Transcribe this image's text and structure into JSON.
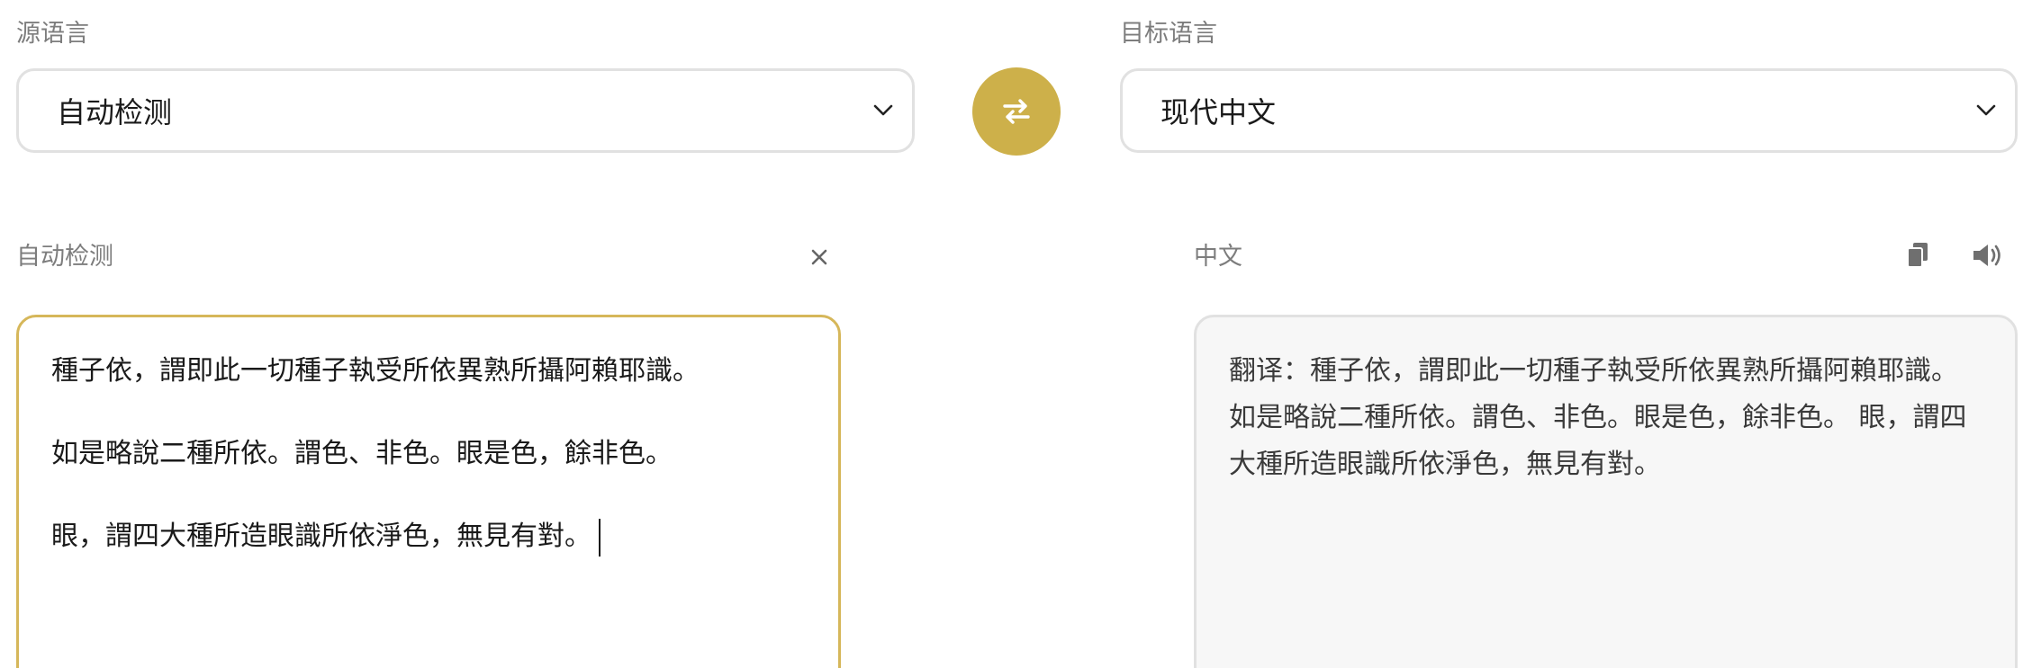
{
  "source_language": {
    "label": "源语言",
    "selected": "自动检测"
  },
  "target_language": {
    "label": "目标语言",
    "selected": "现代中文"
  },
  "swap_button": {
    "icon": "swap-arrows-icon",
    "color": "#cdb04a"
  },
  "source_panel": {
    "label": "自动检测",
    "clear_icon": "close-icon",
    "lines": [
      "種子依，謂即此一切種子執受所依異熟所攝阿賴耶識。",
      "如是略說二種所依。謂色、非色。眼是色，餘非色。",
      "眼，謂四大種所造眼識所依淨色，無見有對。"
    ],
    "accent_color": "#d6b75a"
  },
  "target_panel": {
    "label": "中文",
    "copy_icon": "copy-icon",
    "speaker_icon": "speaker-icon",
    "text": "翻译：種子依，謂即此一切種子執受所依異熟所攝阿賴耶識。 如是略說二種所依。謂色、非色。眼是色，餘非色。 眼，謂四大種所造眼識所依淨色，無見有對。"
  }
}
